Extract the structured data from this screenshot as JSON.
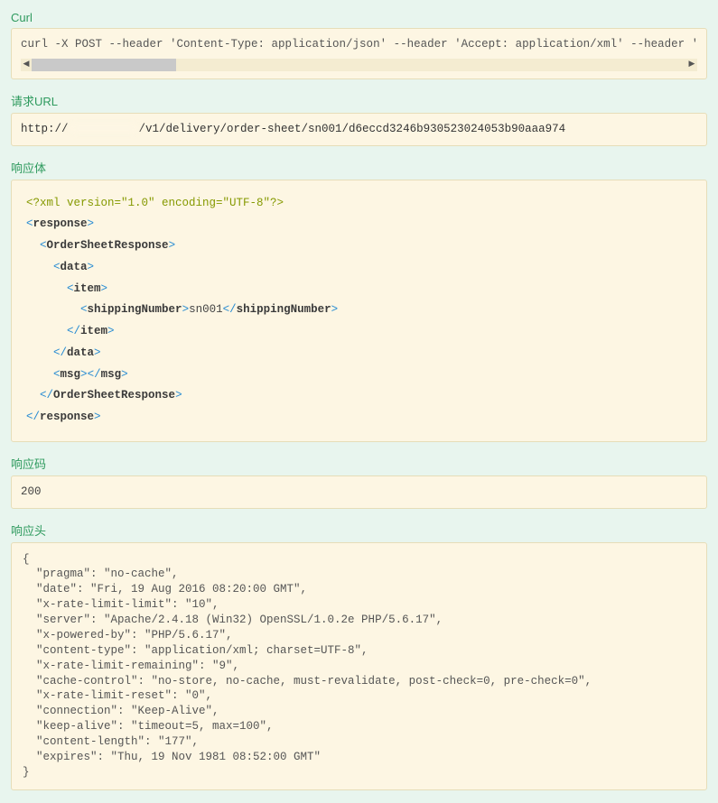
{
  "labels": {
    "curl": "Curl",
    "request_url": "请求URL",
    "response_body": "响应体",
    "response_code": "响应码",
    "response_headers": "响应头"
  },
  "curl_command": "curl -X POST --header 'Content-Type: application/json' --header 'Accept: application/xml' --header 'Autho",
  "request_url": {
    "prefix": "http://",
    "suffix": "/v1/delivery/order-sheet/sn001/d6eccd3246b930523024053b90aaa974"
  },
  "response_body_xml": {
    "declaration": "<?xml version=\"1.0\" encoding=\"UTF-8\"?>",
    "lines": [
      {
        "indent": 0,
        "open": "response"
      },
      {
        "indent": 1,
        "open": "OrderSheetResponse"
      },
      {
        "indent": 2,
        "open": "data"
      },
      {
        "indent": 3,
        "open": "item"
      },
      {
        "indent": 4,
        "open": "shippingNumber",
        "text": "sn001",
        "close": "shippingNumber",
        "inline": true
      },
      {
        "indent": 3,
        "close": "item"
      },
      {
        "indent": 2,
        "close": "data"
      },
      {
        "indent": 2,
        "open": "msg",
        "close": "msg",
        "inline": true
      },
      {
        "indent": 1,
        "close": "OrderSheetResponse"
      },
      {
        "indent": 0,
        "close": "response"
      }
    ]
  },
  "response_code": "200",
  "response_headers": [
    "{",
    "  \"pragma\": \"no-cache\",",
    "  \"date\": \"Fri, 19 Aug 2016 08:20:00 GMT\",",
    "  \"x-rate-limit-limit\": \"10\",",
    "  \"server\": \"Apache/2.4.18 (Win32) OpenSSL/1.0.2e PHP/5.6.17\",",
    "  \"x-powered-by\": \"PHP/5.6.17\",",
    "  \"content-type\": \"application/xml; charset=UTF-8\",",
    "  \"x-rate-limit-remaining\": \"9\",",
    "  \"cache-control\": \"no-store, no-cache, must-revalidate, post-check=0, pre-check=0\",",
    "  \"x-rate-limit-reset\": \"0\",",
    "  \"connection\": \"Keep-Alive\",",
    "  \"keep-alive\": \"timeout=5, max=100\",",
    "  \"content-length\": \"177\",",
    "  \"expires\": \"Thu, 19 Nov 1981 08:52:00 GMT\"",
    "}"
  ]
}
